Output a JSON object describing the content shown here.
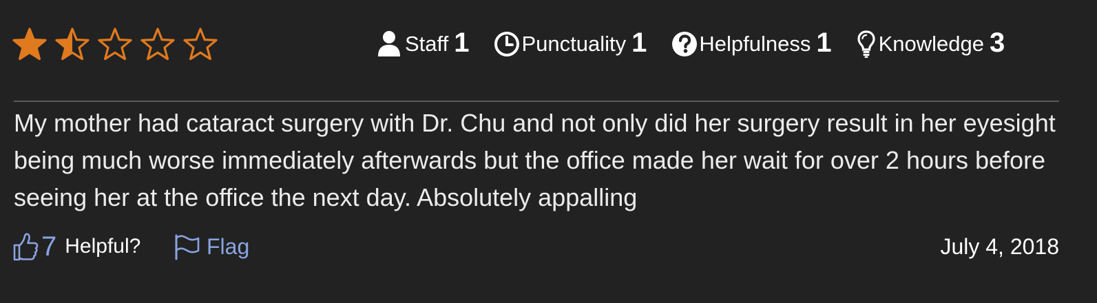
{
  "rating": {
    "value": 1.5,
    "max": 5,
    "color": "#e07a1f"
  },
  "metrics": [
    {
      "icon": "user-icon",
      "label": "Staff",
      "value": "1"
    },
    {
      "icon": "clock-icon",
      "label": "Punctuality",
      "value": "1"
    },
    {
      "icon": "question-circle-icon",
      "label": "Helpfulness",
      "value": "1"
    },
    {
      "icon": "lightbulb-icon",
      "label": "Knowledge",
      "value": "3"
    }
  ],
  "review": {
    "text": "My mother had cataract surgery with Dr. Chu and not only did her surgery result in her eyesight being much worse immediately afterwards but the office made her wait for over 2 hours before seeing her at the office the next day. Absolutely appalling"
  },
  "footer": {
    "helpful_icon": "thumbs-up-icon",
    "helpful_count": "7",
    "helpful_label": "Helpful?",
    "flag_icon": "flag-icon",
    "flag_label": "Flag",
    "date": "July 4, 2018",
    "link_color": "#8aa4e0"
  }
}
